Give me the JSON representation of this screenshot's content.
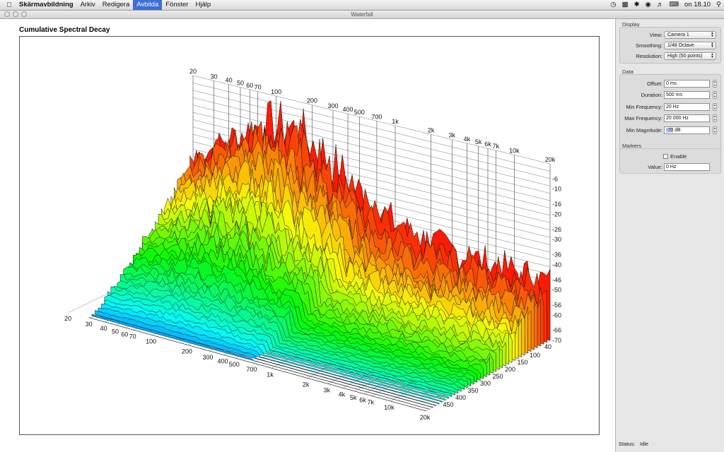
{
  "menubar": {
    "app_name": "Skärmavbildning",
    "items": [
      "Arkiv",
      "Redigera",
      "Avbilda",
      "Fönster",
      "Hjälp"
    ],
    "active_item": "Avbilda",
    "clock": "on 18.10"
  },
  "window": {
    "title": "Waterfall"
  },
  "plot": {
    "title": "Cumulative Spectral Decay"
  },
  "display": {
    "section_title": "Display",
    "view_label": "View:",
    "view_value": "Camera 1",
    "smoothing_label": "Smoothing:",
    "smoothing_value": "1/48 Octave",
    "resolution_label": "Resolution:",
    "resolution_value": "High (50 points)"
  },
  "data": {
    "section_title": "Data",
    "offset_label": "Offset:",
    "offset_value": "0 ms",
    "duration_label": "Duration:",
    "duration_value": "500 ms",
    "min_freq_label": "Min Frequency:",
    "min_freq_value": "20 Hz",
    "max_freq_label": "Max Frequency:",
    "max_freq_value": "20 000 Hz",
    "min_mag_label": "Min Magnitude:",
    "min_mag_value_num": "-70",
    "min_mag_value_unit": " dB"
  },
  "markers": {
    "section_title": "Markers",
    "enable_label": "Enable",
    "value_label": "Value:",
    "value_value": "0 Hz"
  },
  "status": {
    "label": "Status:",
    "value": "Idle"
  },
  "chart_data": {
    "type": "area",
    "title": "Cumulative Spectral Decay",
    "frequency_ticks": [
      "20",
      "30",
      "40",
      "50",
      "60",
      "70",
      "100",
      "200",
      "300",
      "400",
      "500",
      "700",
      "1k",
      "2k",
      "3k",
      "4k",
      "5k",
      "6k",
      "7k",
      "10k",
      "20k"
    ],
    "magnitude_ticks": [
      "-6",
      "-10",
      "-16",
      "-20",
      "-26",
      "-30",
      "-36",
      "-40",
      "-46",
      "-50",
      "-56",
      "-60",
      "-66",
      "-70"
    ],
    "time_ticks": [
      "40",
      "100",
      "150",
      "200",
      "250",
      "300",
      "350",
      "400",
      "450"
    ],
    "xlim": [
      20,
      20000
    ],
    "zlim": [
      -70,
      0
    ],
    "tlim": [
      0,
      500
    ]
  }
}
